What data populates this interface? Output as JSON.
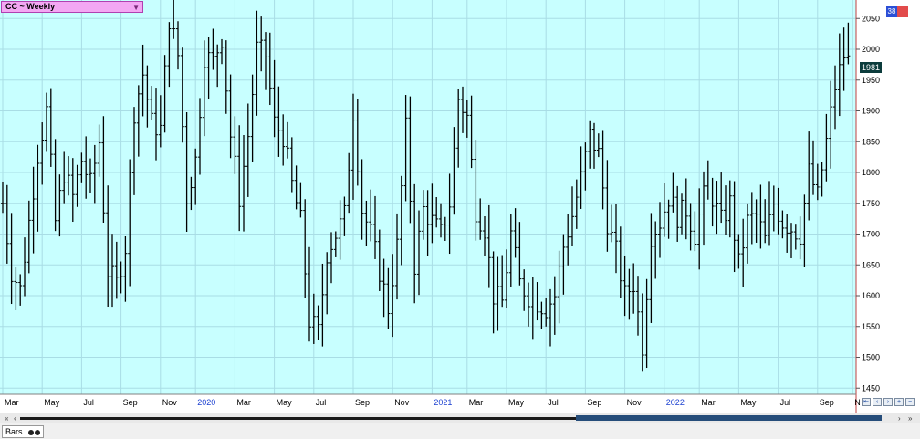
{
  "header": {
    "title": "CC ~ Weekly"
  },
  "badges": {
    "b1": "38",
    "b2": ""
  },
  "status": {
    "tab_label": "Bars"
  },
  "colors": {
    "plot_bg": "#c8ffff",
    "grid": "#a9dde5",
    "bar": "#000000",
    "axis_text": "#000000",
    "year_text": "#1a3fd0",
    "right_line": "#c04040"
  },
  "chart_data": {
    "type": "bar",
    "title": "CC ~ Weekly",
    "style": "ohlc",
    "ylim": [
      1440,
      2080
    ],
    "yticks": [
      1450,
      1500,
      1550,
      1600,
      1650,
      1700,
      1750,
      1800,
      1850,
      1900,
      1950,
      2000,
      2050
    ],
    "last_price": "1981",
    "grid": true,
    "xticks": [
      {
        "label": "Mar",
        "week": 0,
        "year": false
      },
      {
        "label": "May",
        "week": 9,
        "year": false
      },
      {
        "label": "Jul",
        "week": 18,
        "year": false
      },
      {
        "label": "Sep",
        "week": 27,
        "year": false
      },
      {
        "label": "Nov",
        "week": 36,
        "year": false
      },
      {
        "label": "2020",
        "week": 44,
        "year": true
      },
      {
        "label": "Mar",
        "week": 53,
        "year": false
      },
      {
        "label": "May",
        "week": 62,
        "year": false
      },
      {
        "label": "Jul",
        "week": 71,
        "year": false
      },
      {
        "label": "Sep",
        "week": 80,
        "year": false
      },
      {
        "label": "Nov",
        "week": 89,
        "year": false
      },
      {
        "label": "2021",
        "week": 98,
        "year": true
      },
      {
        "label": "Mar",
        "week": 106,
        "year": false
      },
      {
        "label": "May",
        "week": 115,
        "year": false
      },
      {
        "label": "Jul",
        "week": 124,
        "year": false
      },
      {
        "label": "Sep",
        "week": 133,
        "year": false
      },
      {
        "label": "Nov",
        "week": 142,
        "year": false
      },
      {
        "label": "2022",
        "week": 151,
        "year": true
      },
      {
        "label": "Mar",
        "week": 159,
        "year": false
      },
      {
        "label": "May",
        "week": 168,
        "year": false
      },
      {
        "label": "Jul",
        "week": 177,
        "year": false
      },
      {
        "label": "Sep",
        "week": 186,
        "year": false
      },
      {
        "label": "N",
        "week": 194,
        "year": false
      }
    ],
    "close_path": [
      [
        0,
        1750
      ],
      [
        2,
        1640
      ],
      [
        4,
        1610
      ],
      [
        6,
        1720
      ],
      [
        8,
        1830
      ],
      [
        10,
        1900
      ],
      [
        12,
        1720
      ],
      [
        14,
        1800
      ],
      [
        16,
        1760
      ],
      [
        18,
        1820
      ],
      [
        20,
        1780
      ],
      [
        22,
        1850
      ],
      [
        24,
        1640
      ],
      [
        26,
        1620
      ],
      [
        28,
        1680
      ],
      [
        30,
        1900
      ],
      [
        32,
        1960
      ],
      [
        34,
        1880
      ],
      [
        36,
        1870
      ],
      [
        38,
        2050
      ],
      [
        40,
        1990
      ],
      [
        42,
        1760
      ],
      [
        44,
        1820
      ],
      [
        46,
        1990
      ],
      [
        48,
        1980
      ],
      [
        50,
        2020
      ],
      [
        52,
        1860
      ],
      [
        54,
        1760
      ],
      [
        56,
        1860
      ],
      [
        58,
        2000
      ],
      [
        60,
        1990
      ],
      [
        62,
        1880
      ],
      [
        64,
        1860
      ],
      [
        66,
        1780
      ],
      [
        68,
        1720
      ],
      [
        70,
        1560
      ],
      [
        72,
        1540
      ],
      [
        74,
        1670
      ],
      [
        76,
        1700
      ],
      [
        78,
        1730
      ],
      [
        80,
        1900
      ],
      [
        82,
        1740
      ],
      [
        84,
        1700
      ],
      [
        86,
        1640
      ],
      [
        88,
        1580
      ],
      [
        90,
        1680
      ],
      [
        92,
        1870
      ],
      [
        94,
        1650
      ],
      [
        96,
        1740
      ],
      [
        98,
        1720
      ],
      [
        100,
        1700
      ],
      [
        102,
        1750
      ],
      [
        104,
        1920
      ],
      [
        106,
        1890
      ],
      [
        108,
        1740
      ],
      [
        110,
        1710
      ],
      [
        112,
        1600
      ],
      [
        114,
        1590
      ],
      [
        116,
        1700
      ],
      [
        118,
        1620
      ],
      [
        120,
        1600
      ],
      [
        122,
        1590
      ],
      [
        124,
        1580
      ],
      [
        126,
        1600
      ],
      [
        128,
        1680
      ],
      [
        130,
        1730
      ],
      [
        132,
        1790
      ],
      [
        134,
        1860
      ],
      [
        136,
        1830
      ],
      [
        138,
        1720
      ],
      [
        140,
        1670
      ],
      [
        142,
        1600
      ],
      [
        144,
        1620
      ],
      [
        146,
        1520
      ],
      [
        148,
        1700
      ],
      [
        150,
        1720
      ],
      [
        152,
        1760
      ],
      [
        154,
        1730
      ],
      [
        156,
        1740
      ],
      [
        158,
        1700
      ],
      [
        160,
        1760
      ],
      [
        162,
        1760
      ],
      [
        164,
        1720
      ],
      [
        166,
        1750
      ],
      [
        168,
        1650
      ],
      [
        170,
        1720
      ],
      [
        172,
        1730
      ],
      [
        174,
        1690
      ],
      [
        176,
        1750
      ],
      [
        178,
        1720
      ],
      [
        180,
        1710
      ],
      [
        182,
        1700
      ],
      [
        184,
        1800
      ],
      [
        186,
        1760
      ],
      [
        188,
        1850
      ],
      [
        190,
        1940
      ],
      [
        192,
        1990
      ],
      [
        193,
        1981
      ]
    ]
  }
}
